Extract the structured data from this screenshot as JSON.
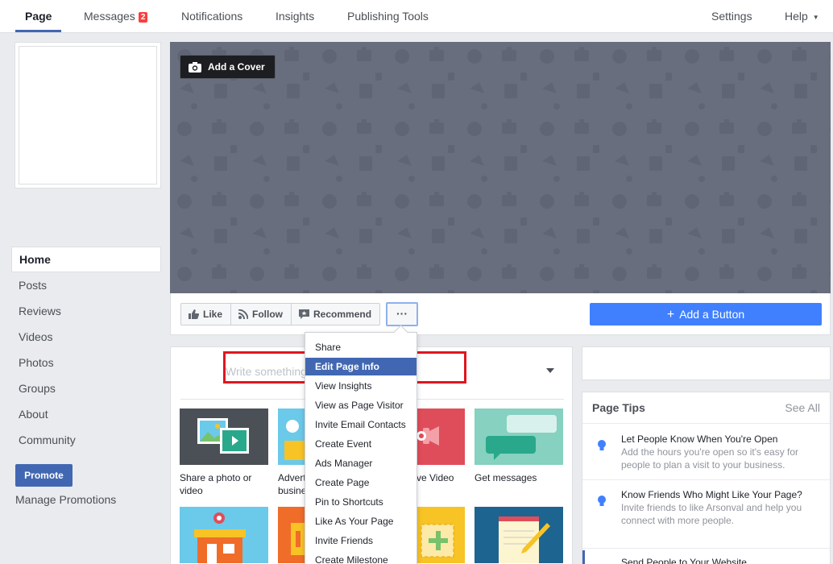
{
  "topnav": {
    "tabs": [
      {
        "label": "Page",
        "active": true
      },
      {
        "label": "Messages",
        "badge": "2"
      },
      {
        "label": "Notifications"
      },
      {
        "label": "Insights"
      },
      {
        "label": "Publishing Tools"
      }
    ],
    "settings": "Settings",
    "help": "Help"
  },
  "leftnav": {
    "items": [
      "Home",
      "Posts",
      "Reviews",
      "Videos",
      "Photos",
      "Groups",
      "About",
      "Community"
    ],
    "active": "Home",
    "promote": "Promote",
    "manage_promotions": "Manage Promotions"
  },
  "cover": {
    "add_cover": "Add a Cover",
    "color": "#686e7d"
  },
  "actions": {
    "like": "Like",
    "follow": "Follow",
    "recommend": "Recommend",
    "more": "···",
    "add_button": "Add a Button"
  },
  "composer": {
    "placeholder": "Write something"
  },
  "tiles": [
    {
      "label": "Share a photo or video",
      "color": "#4b4f56"
    },
    {
      "label": "Advertise your business",
      "color": "#6bc9ea"
    },
    {
      "label": "Start a Live Video",
      "color": "#e04d5a"
    },
    {
      "label": "Get messages",
      "color": "#86d1bf"
    },
    {
      "label": "",
      "color": "#6bc9ea"
    },
    {
      "label": "",
      "color": "#f06c29"
    },
    {
      "label": "",
      "color": "#f7c325"
    },
    {
      "label": "",
      "color": "#1e6491"
    }
  ],
  "tile_labels_visible": {
    "t0": "Share a photo or video",
    "t1": "Advert busine",
    "t2": "ve Video",
    "t3": "Get messages"
  },
  "dropdown": {
    "items": [
      "Share",
      "Edit Page Info",
      "View Insights",
      "View as Page Visitor",
      "Invite Email Contacts",
      "Create Event",
      "Ads Manager",
      "Create Page",
      "Pin to Shortcuts",
      "Like As Your Page",
      "Invite Friends",
      "Create Milestone"
    ],
    "active": "Edit Page Info"
  },
  "tips": {
    "title": "Page Tips",
    "see_all": "See All",
    "items": [
      {
        "title": "Let People Know When You're Open",
        "desc": "Add the hours you're open so it's easy for people to plan a visit to your business."
      },
      {
        "title": "Know Friends Who Might Like Your Page?",
        "desc": "Invite friends to like Arsonval and help you connect with more people."
      },
      {
        "title": "Send People to Your Website",
        "desc": ""
      }
    ]
  },
  "colors": {
    "brand": "#4267b2",
    "button_blue": "#4080ff",
    "highlight": "#e0161e"
  }
}
